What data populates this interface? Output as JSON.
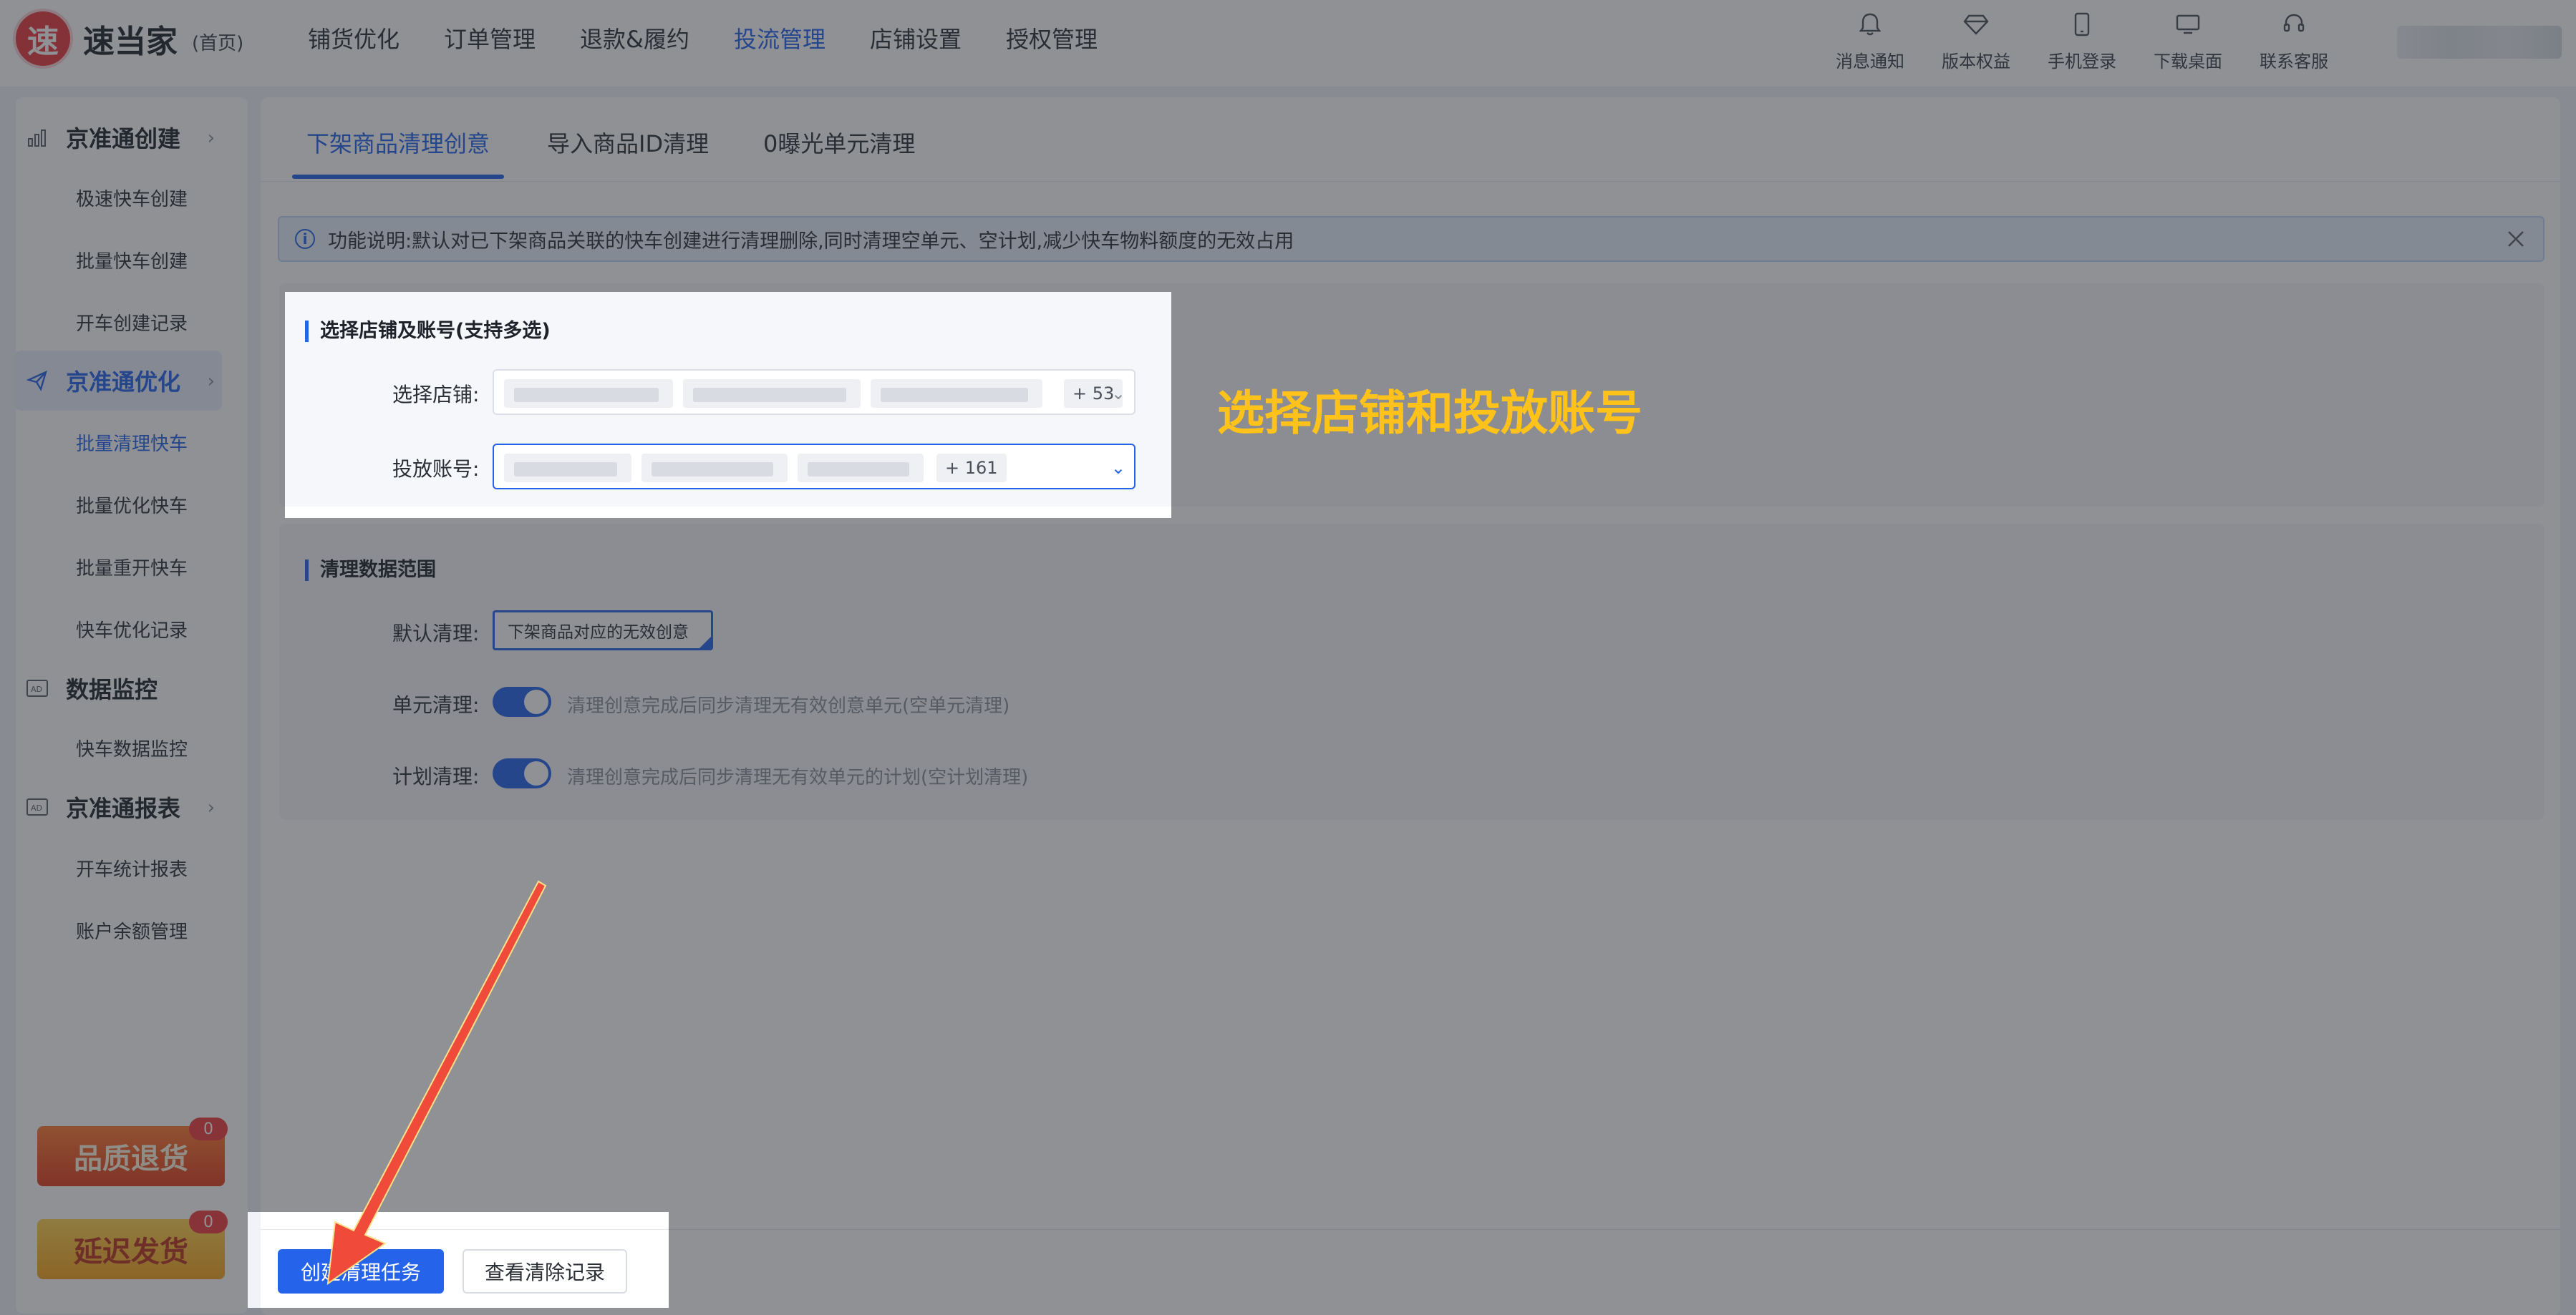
{
  "brand": {
    "logo_char": "速",
    "name": "速当家",
    "sub": "(首页)"
  },
  "nav": [
    "铺货优化",
    "订单管理",
    "退款&履约",
    "投流管理",
    "店铺设置",
    "授权管理"
  ],
  "tools": [
    {
      "label": "消息通知",
      "icon": "bell-icon"
    },
    {
      "label": "版本权益",
      "icon": "diamond-icon"
    },
    {
      "label": "手机登录",
      "icon": "phone-icon"
    },
    {
      "label": "下载桌面",
      "icon": "monitor-icon"
    },
    {
      "label": "联系客服",
      "icon": "headset-icon"
    }
  ],
  "sidebar": {
    "groups": [
      {
        "label": "京准通创建",
        "items": [
          "极速快车创建",
          "批量快车创建",
          "开车创建记录"
        ]
      },
      {
        "label": "京准通优化",
        "items": [
          "批量清理快车",
          "批量优化快车",
          "批量重开快车",
          "快车优化记录"
        ]
      },
      {
        "label": "数据监控",
        "items": [
          "快车数据监控"
        ]
      },
      {
        "label": "京准通报表",
        "items": [
          "开车统计报表",
          "账户余额管理"
        ]
      }
    ],
    "promos": [
      {
        "label": "品质退货",
        "badge": "0"
      },
      {
        "label": "延迟发货",
        "badge": "0"
      }
    ]
  },
  "tabs": [
    "下架商品清理创意",
    "导入商品ID清理",
    "0曝光单元清理"
  ],
  "notice": "功能说明:默认对已下架商品关联的快车创建进行清理删除,同时清理空单元、空计划,减少快车物料额度的无效占用",
  "section1": {
    "title": "选择店铺及账号(支持多选)",
    "shop_label": "选择店铺:",
    "shop_more": "+ 53",
    "account_label": "投放账号:",
    "account_more": "+ 161"
  },
  "section2": {
    "title": "清理数据范围",
    "default_label": "默认清理:",
    "default_value": "下架商品对应的无效创意",
    "unit_label": "单元清理:",
    "unit_hint": "清理创意完成后同步清理无有效创意单元(空单元清理)",
    "plan_label": "计划清理:",
    "plan_hint": "清理创意完成后同步清理无有效单元的计划(空计划清理)"
  },
  "buttons": {
    "create": "创建清理任务",
    "history": "查看清除记录"
  },
  "callout": "选择店铺和投放账号",
  "colors": {
    "accent": "#2563eb",
    "callout": "#ffc21a",
    "arrow": "#f04a3a"
  }
}
